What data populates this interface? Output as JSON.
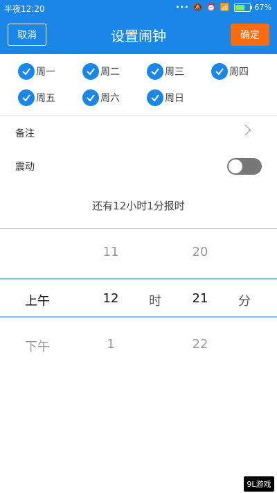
{
  "status": {
    "time": "半夜12:20",
    "battery": "67%",
    "battery_level": 0.67
  },
  "header": {
    "cancel": "取消",
    "title": "设置闹钟",
    "ok": "确定"
  },
  "days": [
    "周一",
    "周二",
    "周三",
    "周四",
    "周五",
    "周六",
    "周日"
  ],
  "settings": {
    "note_label": "备注",
    "vibrate_label": "震动"
  },
  "remaining": "还有12小时1分报时",
  "picker": {
    "ampm": {
      "selected": "上午",
      "next": "下午"
    },
    "hour": {
      "prev": "11",
      "selected": "12",
      "next": "1",
      "unit": "时"
    },
    "minute": {
      "prev": "20",
      "selected": "21",
      "next": "22",
      "unit": "分"
    }
  },
  "colors": {
    "accent": "#1a86e8",
    "confirm": "#fb6b0f",
    "picker_line": "#79c1ec"
  },
  "watermark": "9L游戏"
}
